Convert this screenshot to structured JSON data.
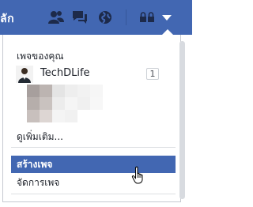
{
  "topbar": {
    "partial_text": "ลัก",
    "icons": [
      "friends-icon",
      "messages-icon",
      "globe-icon",
      "account-switch-icon",
      "dropdown-arrow-icon"
    ],
    "background": "#4267b2"
  },
  "menu": {
    "section_title": "เพจของคุณ",
    "pages": [
      {
        "name": "TechDLife",
        "count": "1"
      }
    ],
    "see_more": "ดูเพิ่มเติม...",
    "items": [
      {
        "label": "สร้างเพจ",
        "active": true
      },
      {
        "label": "จัดการเพจ",
        "active": false
      }
    ]
  },
  "colors": {
    "accent": "#4267b2",
    "text": "#1d2129",
    "divider": "#dddfe2"
  }
}
